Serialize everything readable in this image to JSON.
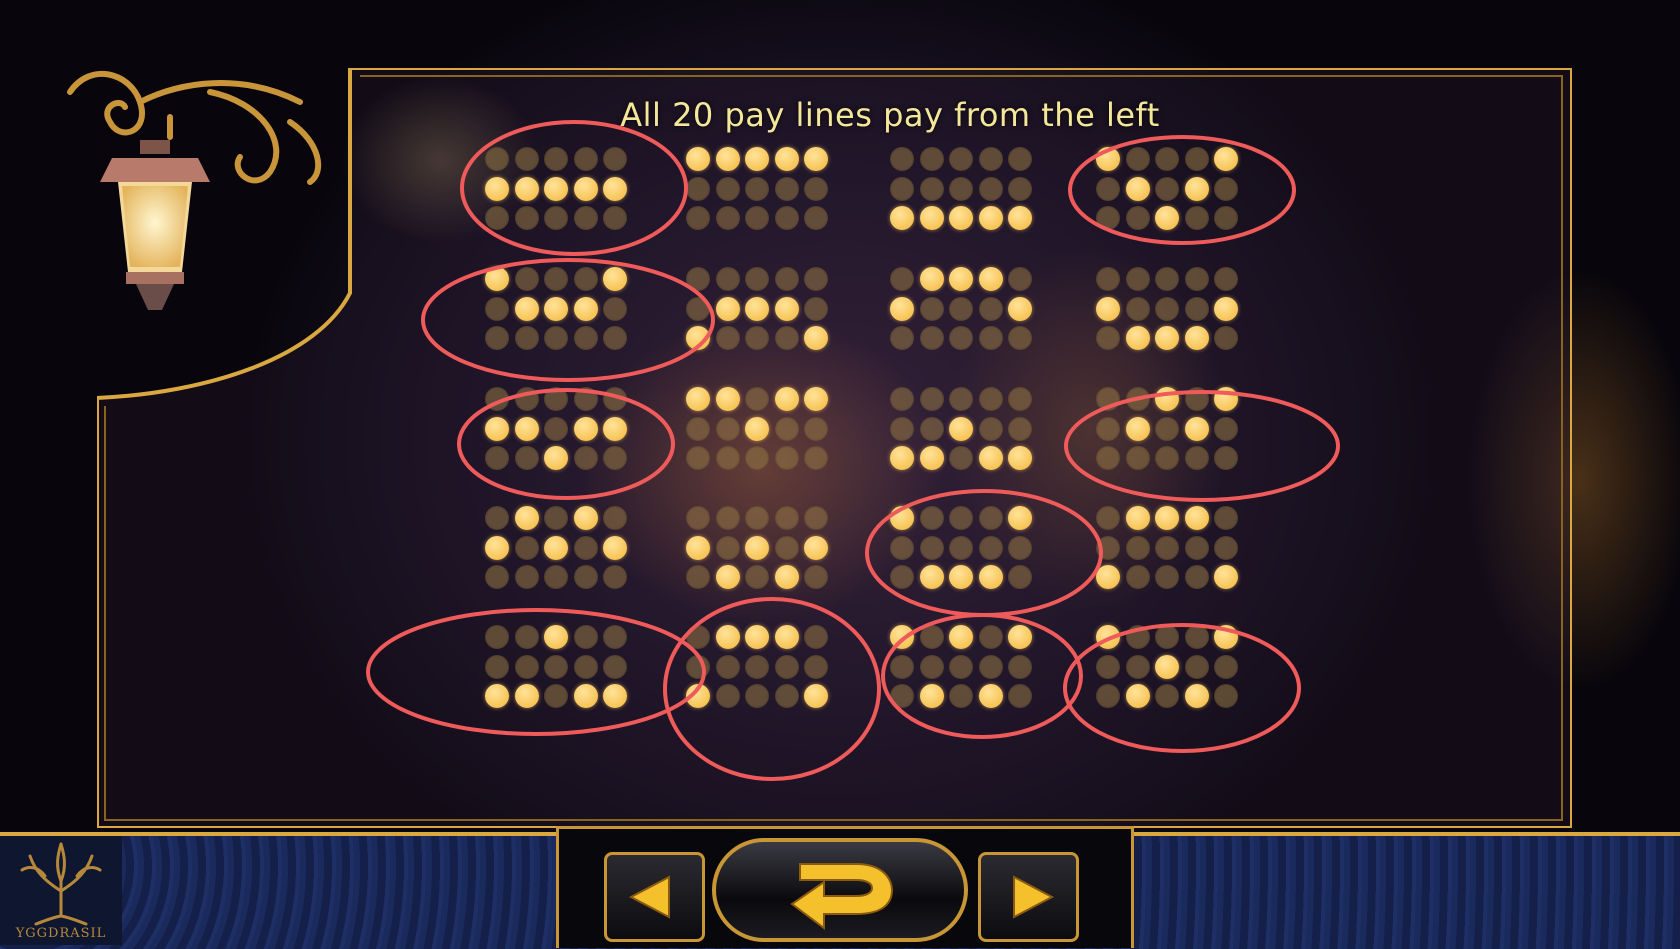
{
  "title": "All 20 pay lines pay from the left",
  "brand": "YGGDRASIL",
  "colors": {
    "dot_on": "#f7c456",
    "dot_off": "#8a7446",
    "circle": "#ef5a5a",
    "frame": "#d9a840"
  },
  "paylines": [
    {
      "rows": [
        [
          0,
          0,
          0,
          0,
          0
        ],
        [
          1,
          1,
          1,
          1,
          1
        ],
        [
          0,
          0,
          0,
          0,
          0
        ]
      ],
      "circled": true
    },
    {
      "rows": [
        [
          1,
          1,
          1,
          1,
          1
        ],
        [
          0,
          0,
          0,
          0,
          0
        ],
        [
          0,
          0,
          0,
          0,
          0
        ]
      ],
      "circled": false
    },
    {
      "rows": [
        [
          0,
          0,
          0,
          0,
          0
        ],
        [
          0,
          0,
          0,
          0,
          0
        ],
        [
          1,
          1,
          1,
          1,
          1
        ]
      ],
      "circled": false
    },
    {
      "rows": [
        [
          1,
          0,
          0,
          0,
          1
        ],
        [
          0,
          1,
          0,
          1,
          0
        ],
        [
          0,
          0,
          1,
          0,
          0
        ]
      ],
      "circled": true
    },
    {
      "rows": [
        [
          1,
          0,
          0,
          0,
          1
        ],
        [
          0,
          1,
          1,
          1,
          0
        ],
        [
          0,
          0,
          0,
          0,
          0
        ]
      ],
      "circled": true
    },
    {
      "rows": [
        [
          0,
          0,
          0,
          0,
          0
        ],
        [
          0,
          1,
          1,
          1,
          0
        ],
        [
          1,
          0,
          0,
          0,
          1
        ]
      ],
      "circled": false
    },
    {
      "rows": [
        [
          0,
          1,
          1,
          1,
          0
        ],
        [
          1,
          0,
          0,
          0,
          1
        ],
        [
          0,
          0,
          0,
          0,
          0
        ]
      ],
      "circled": false
    },
    {
      "rows": [
        [
          0,
          0,
          0,
          0,
          0
        ],
        [
          1,
          0,
          0,
          0,
          1
        ],
        [
          0,
          1,
          1,
          1,
          0
        ]
      ],
      "circled": false
    },
    {
      "rows": [
        [
          0,
          0,
          0,
          0,
          0
        ],
        [
          1,
          1,
          0,
          1,
          1
        ],
        [
          0,
          0,
          1,
          0,
          0
        ]
      ],
      "circled": true
    },
    {
      "rows": [
        [
          1,
          1,
          0,
          1,
          1
        ],
        [
          0,
          0,
          1,
          0,
          0
        ],
        [
          0,
          0,
          0,
          0,
          0
        ]
      ],
      "circled": false
    },
    {
      "rows": [
        [
          0,
          0,
          0,
          0,
          0
        ],
        [
          0,
          0,
          1,
          0,
          0
        ],
        [
          1,
          1,
          0,
          1,
          1
        ]
      ],
      "circled": false
    },
    {
      "rows": [
        [
          0,
          0,
          1,
          0,
          1
        ],
        [
          0,
          1,
          0,
          1,
          0
        ],
        [
          0,
          0,
          0,
          0,
          0
        ]
      ],
      "circled": true
    },
    {
      "rows": [
        [
          0,
          1,
          0,
          1,
          0
        ],
        [
          1,
          0,
          1,
          0,
          1
        ],
        [
          0,
          0,
          0,
          0,
          0
        ]
      ],
      "circled": false
    },
    {
      "rows": [
        [
          0,
          0,
          0,
          0,
          0
        ],
        [
          1,
          0,
          1,
          0,
          1
        ],
        [
          0,
          1,
          0,
          1,
          0
        ]
      ],
      "circled": false
    },
    {
      "rows": [
        [
          1,
          0,
          0,
          0,
          1
        ],
        [
          0,
          0,
          0,
          0,
          0
        ],
        [
          0,
          1,
          1,
          1,
          0
        ]
      ],
      "circled": true
    },
    {
      "rows": [
        [
          0,
          1,
          1,
          1,
          0
        ],
        [
          0,
          0,
          0,
          0,
          0
        ],
        [
          1,
          0,
          0,
          0,
          1
        ]
      ],
      "circled": false
    },
    {
      "rows": [
        [
          0,
          0,
          1,
          0,
          0
        ],
        [
          0,
          0,
          0,
          0,
          0
        ],
        [
          1,
          1,
          0,
          1,
          1
        ]
      ],
      "circled": true
    },
    {
      "rows": [
        [
          0,
          1,
          1,
          1,
          0
        ],
        [
          0,
          0,
          0,
          0,
          0
        ],
        [
          1,
          0,
          0,
          0,
          1
        ]
      ],
      "circled": true
    },
    {
      "rows": [
        [
          1,
          0,
          1,
          0,
          1
        ],
        [
          0,
          0,
          0,
          0,
          0
        ],
        [
          0,
          1,
          0,
          1,
          0
        ]
      ],
      "circled": true
    },
    {
      "rows": [
        [
          1,
          0,
          0,
          0,
          1
        ],
        [
          0,
          0,
          1,
          0,
          0
        ],
        [
          0,
          1,
          0,
          1,
          0
        ]
      ],
      "circled": true
    }
  ],
  "nav": {
    "prev": "previous-page",
    "back": "return",
    "next": "next-page"
  }
}
